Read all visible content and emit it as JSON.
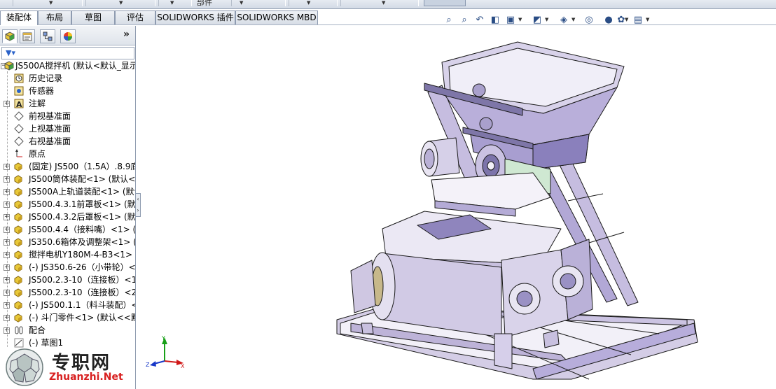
{
  "ribbon": {
    "partial_label": "部件"
  },
  "command_tabs": [
    {
      "label": "装配体",
      "active": true
    },
    {
      "label": "布局",
      "active": false
    },
    {
      "label": "草图",
      "active": false
    },
    {
      "label": "评估",
      "active": false
    },
    {
      "label": "SOLIDWORKS 插件",
      "active": false
    },
    {
      "label": "SOLIDWORKS MBD",
      "active": false
    }
  ],
  "view_toolbar": [
    {
      "icon": "zoom-to-fit-icon",
      "glyph": "⌕"
    },
    {
      "icon": "zoom-area-icon",
      "glyph": "⌕"
    },
    {
      "icon": "previous-view-icon",
      "glyph": "↶"
    },
    {
      "icon": "section-view-icon",
      "glyph": "◧"
    },
    {
      "icon": "dynamic-annotation-icon",
      "glyph": "▣"
    },
    {
      "icon": "view-orientation-icon",
      "glyph": "◩"
    },
    {
      "icon": "display-style-icon",
      "glyph": "◈"
    },
    {
      "icon": "hide-show-icon",
      "glyph": "◎"
    },
    {
      "icon": "edit-appearance-icon",
      "glyph": "●"
    },
    {
      "icon": "apply-scene-icon",
      "glyph": "✿"
    },
    {
      "icon": "view-settings-icon",
      "glyph": "▤"
    }
  ],
  "manager_tabs": [
    {
      "icon": "feature-manager-icon"
    },
    {
      "icon": "property-manager-icon"
    },
    {
      "icon": "configuration-manager-icon"
    },
    {
      "icon": "display-manager-icon"
    }
  ],
  "panel": {
    "expand_glyph": "»"
  },
  "tree": {
    "root_label": "JS500A搅拌机 (默认<默认_显示",
    "items": [
      {
        "label": "历史记录",
        "icon": "history-icon",
        "expandable": false
      },
      {
        "label": "传感器",
        "icon": "sensor-icon",
        "expandable": false
      },
      {
        "label": "注解",
        "icon": "annotation-icon",
        "expandable": true
      },
      {
        "label": "前视基准面",
        "icon": "plane-icon",
        "expandable": false
      },
      {
        "label": "上视基准面",
        "icon": "plane-icon",
        "expandable": false
      },
      {
        "label": "右视基准面",
        "icon": "plane-icon",
        "expandable": false
      },
      {
        "label": "原点",
        "icon": "origin-icon",
        "expandable": false
      },
      {
        "label": "(固定) JS500（1.5A）.8.9底",
        "icon": "subassembly-icon",
        "expandable": true
      },
      {
        "label": "JS500筒体装配<1> (默认<",
        "icon": "subassembly-icon",
        "expandable": true
      },
      {
        "label": "JS500A上轨道装配<1> (默认",
        "icon": "subassembly-icon",
        "expandable": true
      },
      {
        "label": "JS500.4.3.1前罩板<1> (默认",
        "icon": "subassembly-icon",
        "expandable": true
      },
      {
        "label": "JS500.4.3.2后罩板<1> (默认",
        "icon": "subassembly-icon",
        "expandable": true
      },
      {
        "label": "JS500.4.4（接料嘴）<1> (默",
        "icon": "subassembly-icon",
        "expandable": true
      },
      {
        "label": "JS350.6箱体及调整架<1> (默",
        "icon": "subassembly-icon",
        "expandable": true
      },
      {
        "label": "搅拌电机Y180M-4-B3<1> (",
        "icon": "subassembly-icon",
        "expandable": true
      },
      {
        "label": "(-) JS350.6-26（小带轮）<",
        "icon": "subassembly-icon",
        "expandable": true
      },
      {
        "label": "JS500.2.3-10（连接板）<1",
        "icon": "subassembly-icon",
        "expandable": true
      },
      {
        "label": "JS500.2.3-10（连接板）<2",
        "icon": "subassembly-icon",
        "expandable": true
      },
      {
        "label": "(-) JS500.1.1（料斗装配）<",
        "icon": "subassembly-icon",
        "expandable": true
      },
      {
        "label": "(-) 斗门零件<1> (默认<<默",
        "icon": "subassembly-icon",
        "expandable": true
      },
      {
        "label": "配合",
        "icon": "mates-icon",
        "expandable": true
      },
      {
        "label": "(-) 草图1",
        "icon": "sketch-icon",
        "expandable": false
      }
    ]
  },
  "watermark": {
    "text": "专职网",
    "url": "Zhuanzhi.Net"
  },
  "triad": {
    "x_label": "X",
    "y_label": "Y",
    "z_label": "Z"
  },
  "colors": {
    "model_face": "#c8c0df",
    "model_edge": "#1a1a1a",
    "triad_x": "#d01818",
    "triad_y": "#18a018",
    "triad_z": "#1838c8",
    "watermark_url": "#d82020"
  }
}
